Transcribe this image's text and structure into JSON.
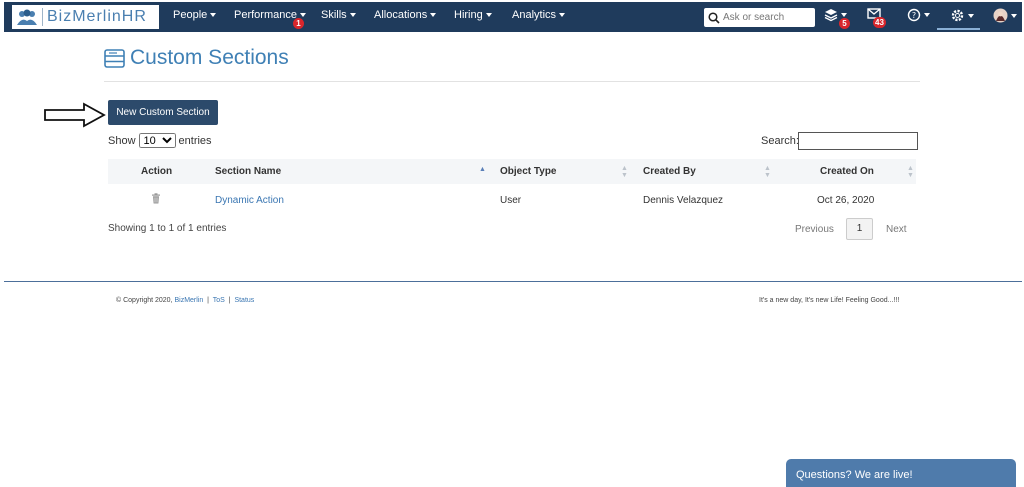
{
  "brand": {
    "name": "BizMerlinHR"
  },
  "nav": {
    "items": [
      {
        "label": "People"
      },
      {
        "label": "Performance",
        "badge": "1"
      },
      {
        "label": "Skills"
      },
      {
        "label": "Allocations"
      },
      {
        "label": "Hiring"
      },
      {
        "label": "Analytics"
      }
    ],
    "search_placeholder": "Ask or search",
    "layers_badge": "5",
    "mail_badge": "43"
  },
  "page": {
    "title": "Custom Sections",
    "new_button_label": "New Custom Section",
    "show_label": "Show",
    "entries_value": "10",
    "entries_label": "entries",
    "search_label": "Search:"
  },
  "table": {
    "columns": [
      "Action",
      "Section Name",
      "Object Type",
      "Created By",
      "Created On"
    ],
    "rows": [
      {
        "section_name": "Dynamic Action",
        "object_type": "User",
        "created_by": "Dennis Velazquez",
        "created_on": "Oct 26, 2020"
      }
    ],
    "info": "Showing 1 to 1 of 1 entries"
  },
  "pagination": {
    "previous": "Previous",
    "page": "1",
    "next": "Next"
  },
  "footer": {
    "copyright": "© Copyright 2020,",
    "company_link": "BizMerlin",
    "separator": "|",
    "tos": "ToS",
    "status": "Status",
    "tagline": "It's a new day, It's new Life! Feeling Good...!!!"
  },
  "chat": {
    "label": "Questions? We are live!"
  },
  "colors": {
    "nav_bg": "#1f3b5c",
    "accent": "#3f80b5",
    "button": "#2c4a6b",
    "badge": "#d9262c"
  }
}
